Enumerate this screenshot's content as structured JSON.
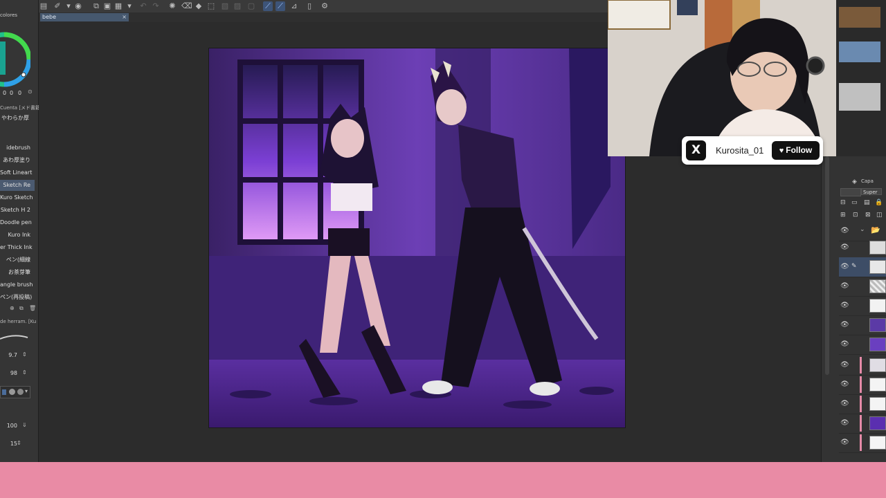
{
  "tab": {
    "name": "bebe",
    "close": "×"
  },
  "left_panel": {
    "header": "colores",
    "color_values": [
      "0",
      "0",
      "0"
    ],
    "brush_category": "Cuenta [メド書籍",
    "brush_group": "やわらか厚",
    "brushes": [
      {
        "label": "idebrush"
      },
      {
        "label": "あわ厚塗り"
      },
      {
        "label": "Soft Lineart"
      },
      {
        "label": "Sketch Re",
        "selected": true
      },
      {
        "label": "Kuro Sketch"
      },
      {
        "label": "Sketch H 2"
      },
      {
        "label": "Doodle pen"
      },
      {
        "label": "Kuro Ink"
      },
      {
        "label": "er Thick Ink"
      },
      {
        "label": "ペン(細線"
      },
      {
        "label": "お茶芽筆"
      },
      {
        "label": "angle brush"
      },
      {
        "label": "ペン(再投稿)"
      }
    ],
    "tool_property_header": "de herram. [Ku",
    "brush_size": "9.7",
    "opacity": "98",
    "anti_alias": "100",
    "stabilization": "15"
  },
  "right_panel": {
    "header": "Capa",
    "blend_mode": "Super",
    "layer_count": 12
  },
  "stream_overlay": {
    "platform_icon": "x-logo-icon",
    "logo_text": "X",
    "handle": "Kurosita_01",
    "follow_label": "Follow"
  },
  "colors": {
    "pink_bar": "#e98ba5",
    "app_bg": "#2b2b2b",
    "accent": "#3d5478"
  }
}
